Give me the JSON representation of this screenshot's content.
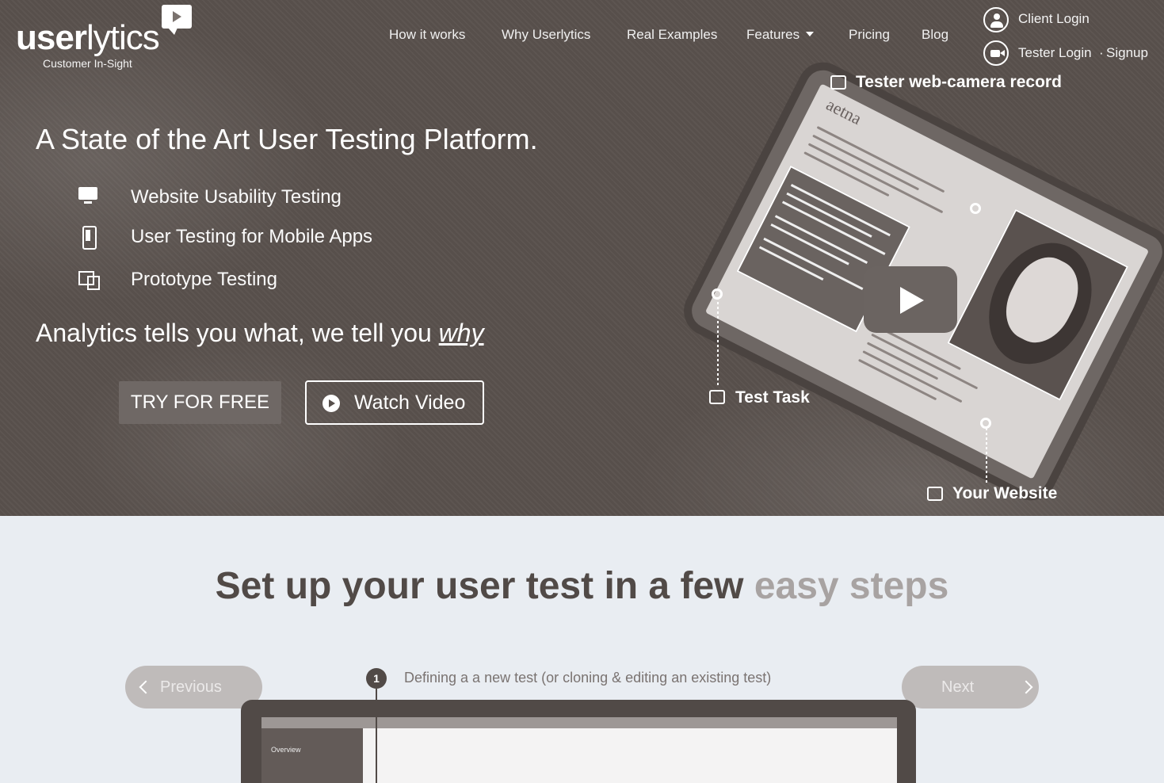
{
  "logo": {
    "text_bold": "user",
    "text_rest": "lytics",
    "tagline": "Customer In-Sight"
  },
  "nav": {
    "items": [
      "How it works",
      "Why Userlytics",
      "Real Examples",
      "Features",
      "Pricing",
      "Blog"
    ],
    "client_login": "Client Login",
    "tester_login": "Tester Login",
    "signup": "Signup",
    "separator": "·"
  },
  "hero": {
    "title": "A State of the Art User Testing Platform.",
    "features": [
      {
        "label": "Website Usability Testing",
        "icon": "monitor-icon"
      },
      {
        "label": "User Testing for Mobile Apps",
        "icon": "phone-icon"
      },
      {
        "label": "Prototype Testing",
        "icon": "prototype-icon"
      }
    ],
    "tagline_prefix": "Analytics tells you what, we tell you ",
    "tagline_emphasis": "why",
    "try_button": "TRY FOR FREE",
    "watch_button": "Watch Video",
    "mockup": {
      "brand": "aetna",
      "callout_camera": "Tester web-camera record",
      "callout_task": "Test Task",
      "callout_website": "Your Website"
    }
  },
  "steps": {
    "title_main": "Set up your user test in a few ",
    "title_accent": "easy steps",
    "prev_label": "Previous",
    "next_label": "Next",
    "current_number": "1",
    "current_text": "Defining a a new test (or cloning & editing an existing test)",
    "preview_sidebar": "Overview"
  },
  "colors": {
    "hero_bg": "#574f4b",
    "page_bg": "#e9edf2",
    "accent_text": "#a8a3a2",
    "dark_text": "#514a47"
  }
}
